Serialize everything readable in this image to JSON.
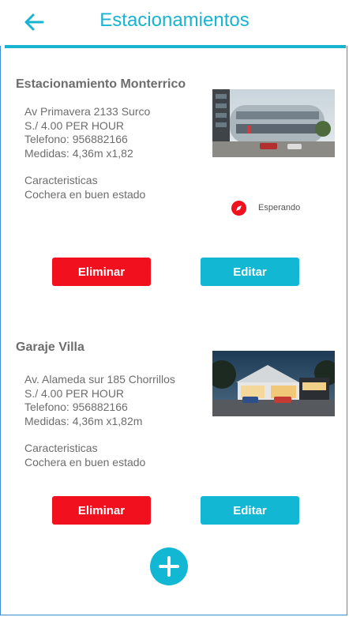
{
  "header": {
    "title": "Estacionamientos"
  },
  "parkings": [
    {
      "name": "Estacionamiento Monterrico",
      "address": "Av Primavera 2133 Surco",
      "price": "S./ 4.00 PER HOUR",
      "phone": "Telefono: 956882166",
      "size": "Medidas: 4,36m x1,82",
      "features_title": "Caracteristicas",
      "features": "Cochera en buen estado",
      "status": "Esperando",
      "delete_label": "Eliminar",
      "edit_label": "Editar"
    },
    {
      "name": "Garaje Villa",
      "address": "Av. Alameda sur 185 Chorrillos",
      "price": "S./ 4.00 PER HOUR",
      "phone": "Telefono: 956882166",
      "size": "Medidas: 4,36m x1,82m",
      "features_title": "Caracteristicas",
      "features": "Cochera en buen estado",
      "delete_label": "Eliminar",
      "edit_label": "Editar"
    }
  ],
  "colors": {
    "accent": "#12b8d3",
    "danger": "#f0101e",
    "text": "#6d6d6d"
  }
}
